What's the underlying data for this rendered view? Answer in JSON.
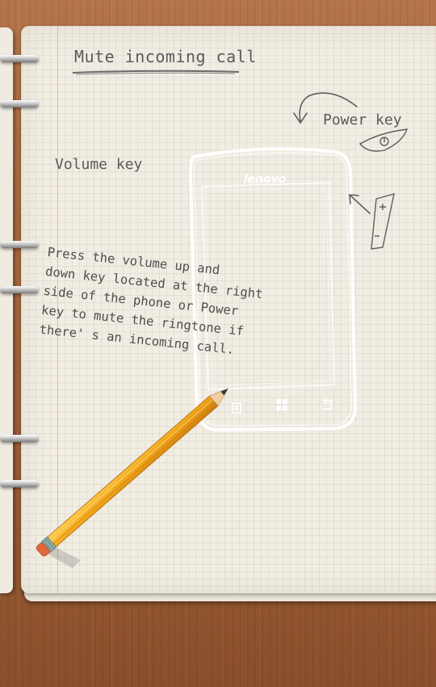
{
  "title": "Mute incoming call",
  "labels": {
    "power_key": "Power key",
    "volume_key": "Volume key"
  },
  "phone": {
    "brand": "lenovo"
  },
  "instructions": [
    "Press the volume up and",
    "down key located at the right",
    "side of the phone or Power",
    "key to mute the ringtone if",
    "there' s an  incoming call."
  ],
  "icons": [
    "power-button-sketch",
    "volume-rocker-sketch",
    "arrow-icon",
    "menu-icon",
    "home-icon",
    "back-icon",
    "pencil-icon"
  ],
  "colors": {
    "wood": "#a4643b",
    "paper": "#f1ede3",
    "ink": "#5a5a5a",
    "pencil": "#f2a71b"
  }
}
